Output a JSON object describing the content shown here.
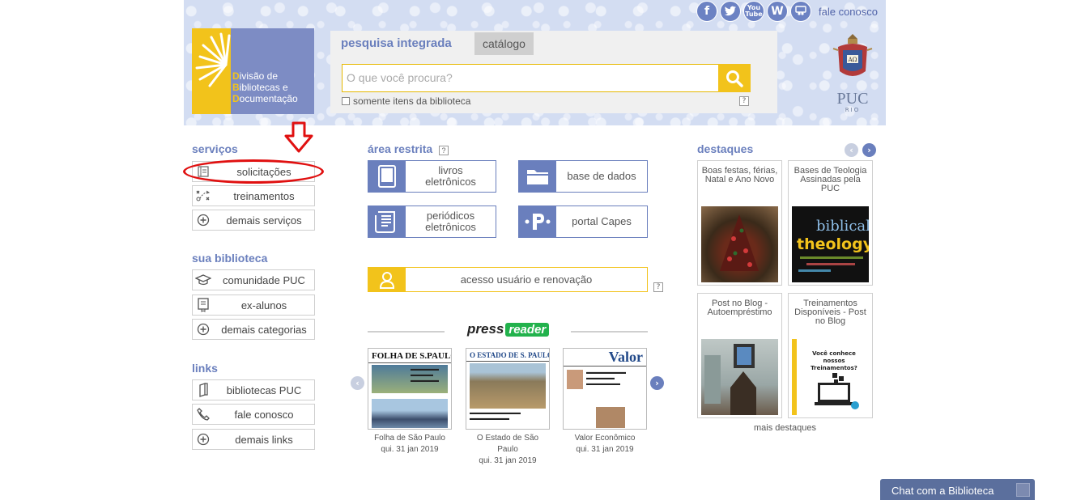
{
  "header": {
    "social": {
      "icons": [
        "facebook-icon",
        "twitter-icon",
        "youtube-icon",
        "wordpress-icon",
        "slideshare-icon"
      ],
      "contact_label": "fale conosco"
    },
    "logo": {
      "line1_initial": "D",
      "line1_rest": "ivisão de",
      "line2_initial": "B",
      "line2_rest": "ibliotecas e",
      "line3_initial": "D",
      "line3_rest": "ocumentação"
    },
    "search": {
      "tab_active": "pesquisa integrada",
      "tab_inactive": "catálogo",
      "placeholder": "O que você procura?",
      "checkbox_label": "somente itens da biblioteca",
      "help": "?"
    },
    "puc": {
      "name": "PUC",
      "sub": "RIO"
    }
  },
  "left": {
    "services_title": "serviços",
    "services": [
      {
        "label": "solicitações",
        "icon": "book-icon"
      },
      {
        "label": "treinamentos",
        "icon": "strategy-icon"
      },
      {
        "label": "demais serviços",
        "icon": "plus-icon"
      }
    ],
    "library_title": "sua biblioteca",
    "library": [
      {
        "label": "comunidade PUC",
        "icon": "graduation-cap-icon"
      },
      {
        "label": "ex-alunos",
        "icon": "certificate-icon"
      },
      {
        "label": "demais categorias",
        "icon": "plus-icon"
      }
    ],
    "links_title": "links",
    "links": [
      {
        "label": "bibliotecas PUC",
        "icon": "book-icon"
      },
      {
        "label": "fale conosco",
        "icon": "phone-icon"
      },
      {
        "label": "demais links",
        "icon": "plus-icon"
      }
    ]
  },
  "center": {
    "restricted_title": "área restrita",
    "help": "?",
    "ebooks_line1": "livros",
    "ebooks_line2": "eletrônicos",
    "databases": "base de dados",
    "periodicals_line1": "periódicos",
    "periodicals_line2": "eletrônicos",
    "capes": "portal Capes",
    "user_access": "acesso usuário e renovação",
    "pressreader": {
      "press": "press",
      "reader": "reader"
    },
    "papers": [
      {
        "masthead": "FOLHA DE S.PAULO",
        "caption": "Folha de São Paulo",
        "date": "qui. 31 jan 2019"
      },
      {
        "masthead": "O ESTADO DE S. PAULO",
        "caption": "O Estado de São Paulo",
        "date": "qui. 31 jan 2019"
      },
      {
        "masthead": "Valor",
        "caption": "Valor Econômico",
        "date": "qui. 31 jan 2019"
      }
    ]
  },
  "right": {
    "highlights_title": "destaques",
    "cards": [
      {
        "title": "Boas festas, férias, Natal e Ano Novo"
      },
      {
        "title": "Bases de Teologia Assinadas pela PUC"
      },
      {
        "title": "Post no Blog - Autoempréstimo"
      },
      {
        "title": "Treinamentos Disponíveis - Post no Blog"
      }
    ],
    "more": "mais destaques",
    "card_image_text": {
      "theology_1": "biblical",
      "theology_2": "theology",
      "training": "Você conhece nossos Treinamentos?"
    }
  },
  "chat": {
    "label": "Chat com a Biblioteca"
  },
  "colors": {
    "accent_blue": "#6a7fbd",
    "accent_yellow": "#f2c31b",
    "annotation_red": "#e01010"
  }
}
